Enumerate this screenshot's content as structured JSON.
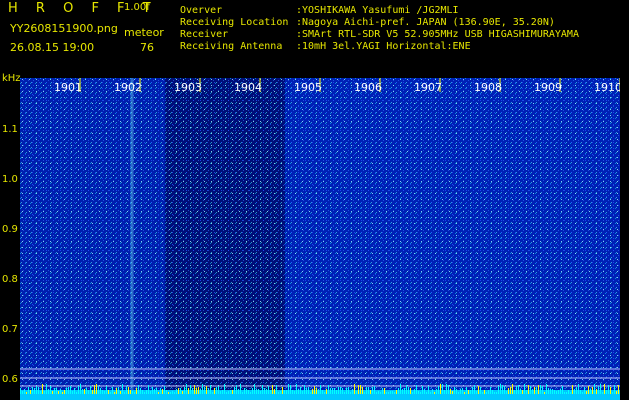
{
  "header": {
    "app_name": "H R O F F T",
    "version": "1.00f",
    "filename": "YY2608151900.png",
    "datetime": "26.08.15 19:00",
    "meteor_label": "meteor",
    "meteor_count": "76"
  },
  "info": [
    {
      "key": "Overver",
      "value": ":YOSHIKAWA Yasufumi /JG2MLI"
    },
    {
      "key": "Receiving Location",
      "value": ":Nagoya Aichi-pref. JAPAN (136.90E, 35.20N)"
    },
    {
      "key": "Receiver",
      "value": ":SMArt RTL-SDR V5 52.905MHz USB HIGASHIMURAYAMA"
    },
    {
      "key": "Receiving Antenna",
      "value": ":10mH 3el.YAGI Horizontal:ENE"
    }
  ],
  "spectrogram": {
    "y_unit": "kHz",
    "y_ticks": [
      "1.1",
      "1.0",
      "0.9",
      "0.8",
      "0.7",
      "0.6"
    ],
    "x_ticks": [
      "1901",
      "1902",
      "1903",
      "1904",
      "1905",
      "1906",
      "1907",
      "1908",
      "1909",
      "1910"
    ],
    "colors": {
      "background": "#000050",
      "noise_low": "#0010a0",
      "noise_high": "#2060ff",
      "speck": "#00ffff",
      "tick_line": "#ffff00",
      "label": "#e6e600"
    }
  }
}
